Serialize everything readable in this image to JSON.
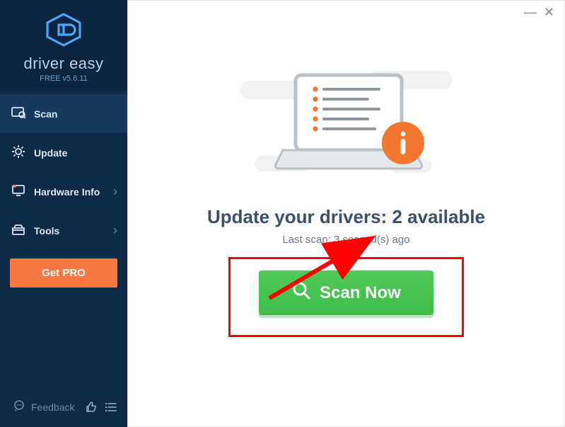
{
  "brand": {
    "name": "driver easy",
    "version": "FREE v5.6.11"
  },
  "sidebar": {
    "items": [
      {
        "label": "Scan",
        "active": true
      },
      {
        "label": "Update",
        "expandable": false
      },
      {
        "label": "Hardware Info",
        "expandable": true
      },
      {
        "label": "Tools",
        "expandable": true
      }
    ],
    "get_pro": "Get PRO",
    "feedback": "Feedback"
  },
  "main": {
    "headline": "Update your drivers: 2 available",
    "subline": "Last scan: 3 second(s) ago",
    "scan_button": "Scan Now"
  }
}
